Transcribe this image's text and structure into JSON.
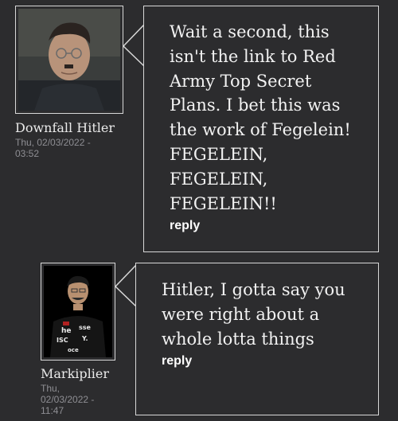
{
  "comments": [
    {
      "author": "Downfall Hitler",
      "timestamp": "Thu, 02/03/2022 - 03:52",
      "text": "Wait a second, this isn't the link to Red Army Top Secret Plans. I bet this was the work of Fegelein! FEGELEIN, FEGELEIN, FEGELEIN!!",
      "reply_label": "reply"
    },
    {
      "author": "Markiplier",
      "timestamp": "Thu, 02/03/2022 - 11:47",
      "text": "Hitler, I gotta say you were right about a whole lotta things",
      "reply_label": "reply"
    }
  ],
  "colors": {
    "background": "#2c2c2e",
    "border": "#d8d8d8",
    "text": "#f2f2f2",
    "muted": "#8e8e93"
  }
}
